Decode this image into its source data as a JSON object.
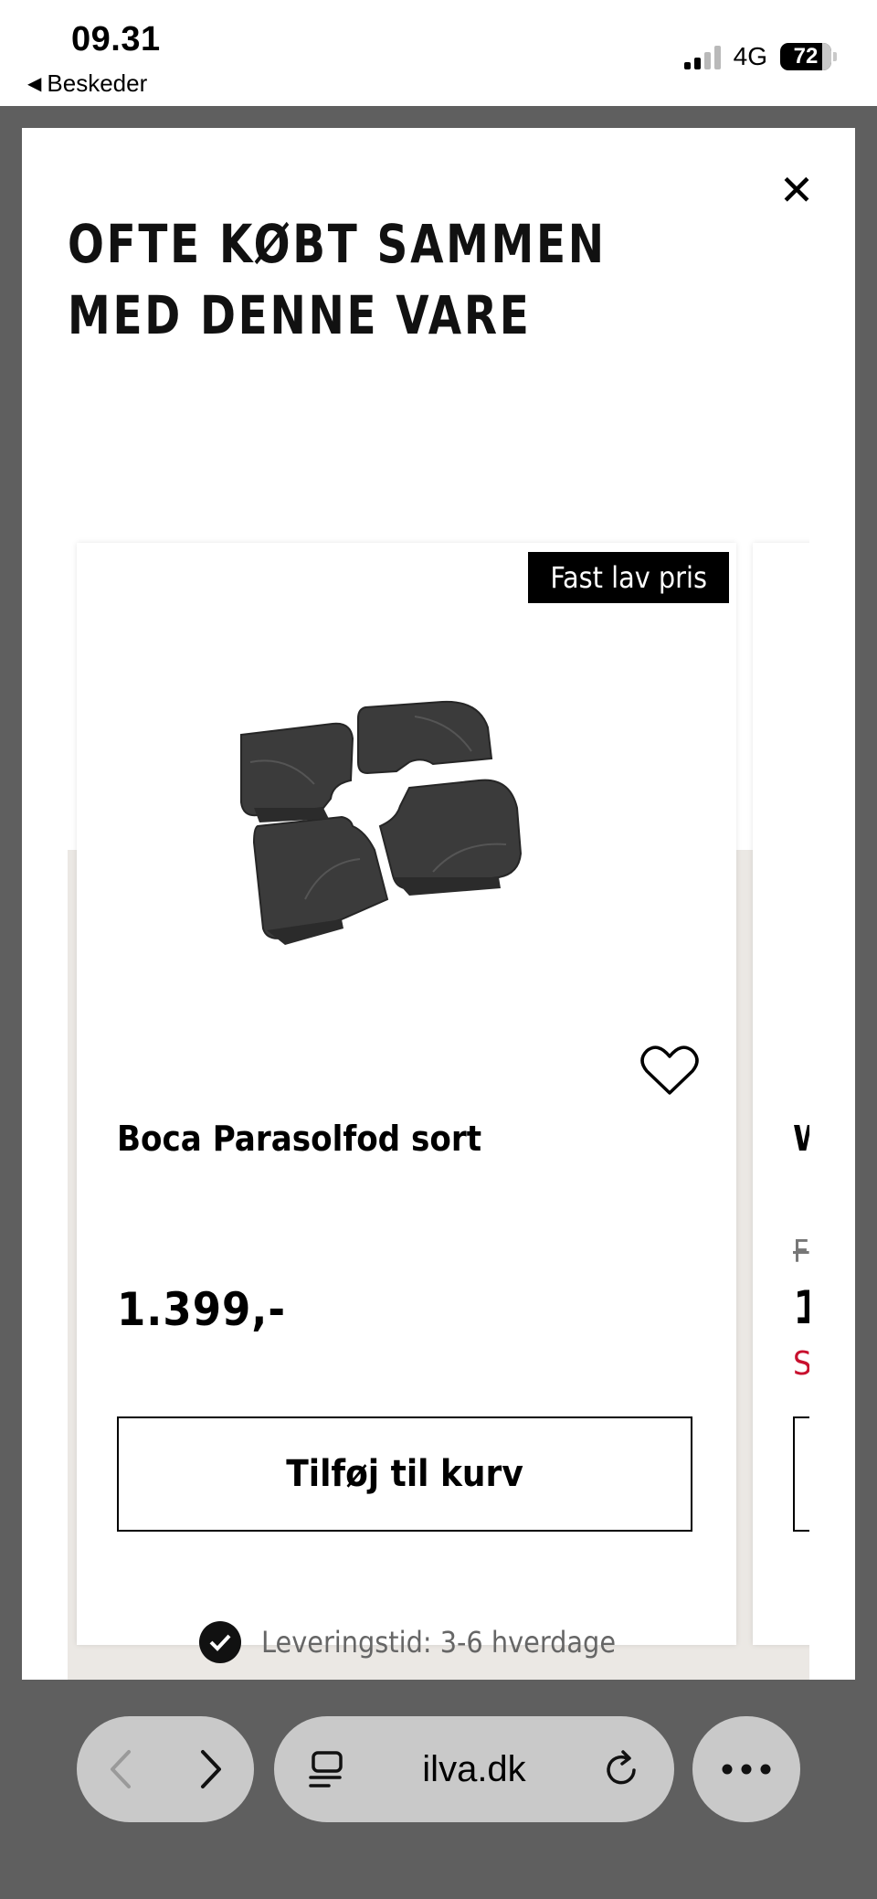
{
  "status_bar": {
    "time": "09.31",
    "back_label": "Beskeder",
    "network": "4G",
    "battery": "72"
  },
  "modal": {
    "title": "OFTE KØBT SAMMEN MED DENNE VARE",
    "close_icon": "close-icon"
  },
  "product": {
    "badge": "Fast lav pris",
    "name": "Boca Parasolfod sort",
    "price": "1.399,-",
    "add_to_cart": "Tilføj til kurv",
    "delivery": "Leveringstid: 3-6 hverdage"
  },
  "next_product": {
    "name_partial": "W",
    "old_price_partial": "F",
    "price_partial": "1",
    "sale_partial": "S"
  },
  "browser": {
    "url": "ilva.dk"
  },
  "colors": {
    "sale_red": "#c8102e",
    "card_backdrop": "#ebe8e4"
  }
}
